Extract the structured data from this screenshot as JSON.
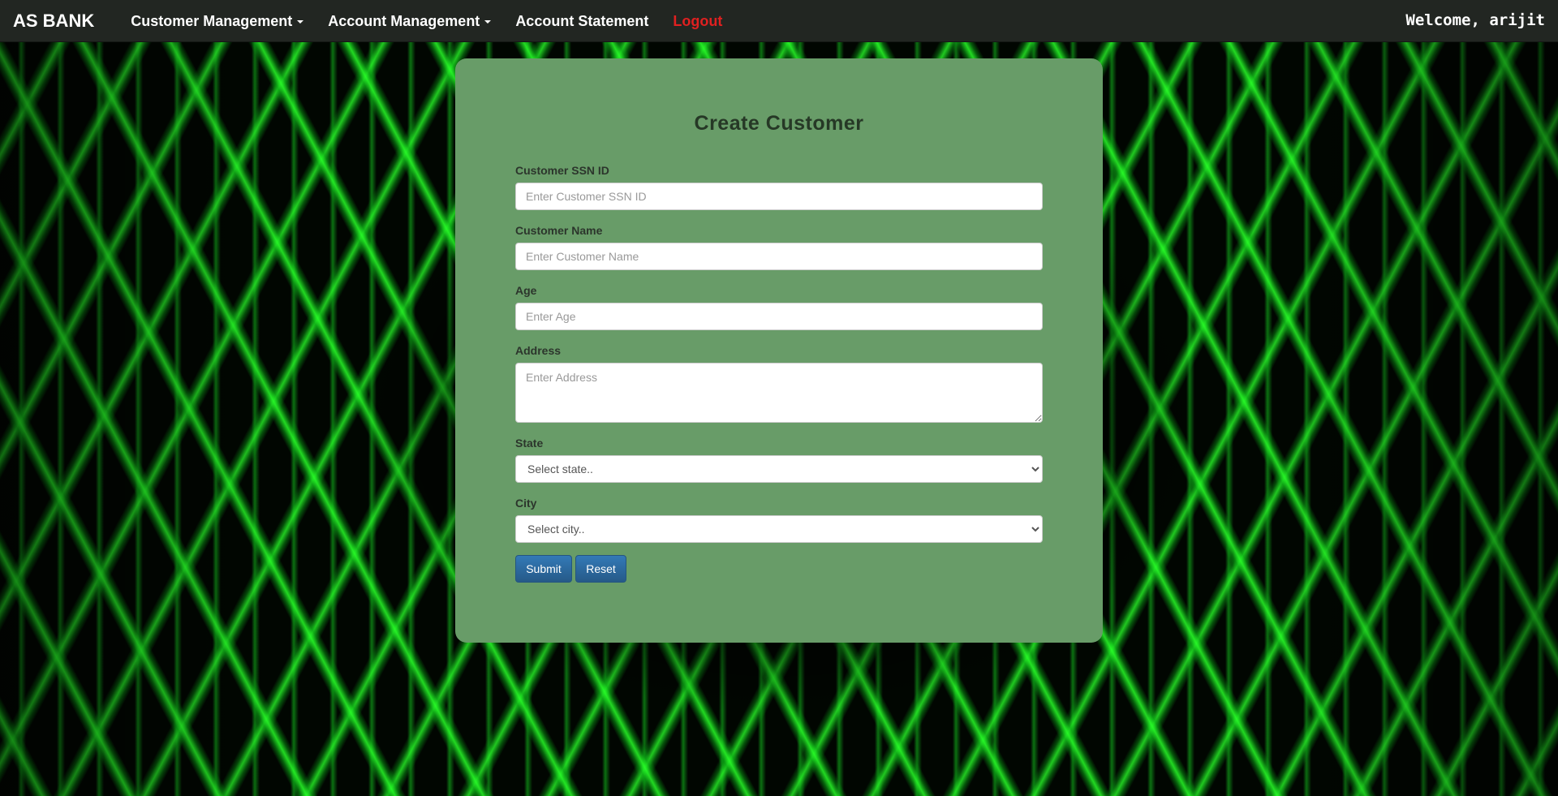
{
  "navbar": {
    "brand": "AS BANK",
    "items": [
      {
        "label": "Customer Management",
        "dropdown": true
      },
      {
        "label": "Account Management",
        "dropdown": true
      },
      {
        "label": "Account Statement",
        "dropdown": false
      },
      {
        "label": "Logout",
        "dropdown": false,
        "color": "#e02020"
      }
    ],
    "welcome": "Welcome, arijit"
  },
  "form": {
    "title": "Create Customer",
    "fields": {
      "ssn": {
        "label": "Customer SSN ID",
        "placeholder": "Enter Customer SSN ID",
        "value": ""
      },
      "name": {
        "label": "Customer Name",
        "placeholder": "Enter Customer Name",
        "value": ""
      },
      "age": {
        "label": "Age",
        "placeholder": "Enter Age",
        "value": ""
      },
      "address": {
        "label": "Address",
        "placeholder": "Enter Address",
        "value": ""
      },
      "state": {
        "label": "State",
        "selected": "Select state.."
      },
      "city": {
        "label": "City",
        "selected": "Select city.."
      }
    },
    "buttons": {
      "submit": "Submit",
      "reset": "Reset"
    }
  },
  "colors": {
    "navbar_bg": "#222622",
    "card_bg": "#689c68",
    "button_primary": "#337ab7",
    "logout": "#e02020",
    "background_glow": "#22ff22"
  }
}
